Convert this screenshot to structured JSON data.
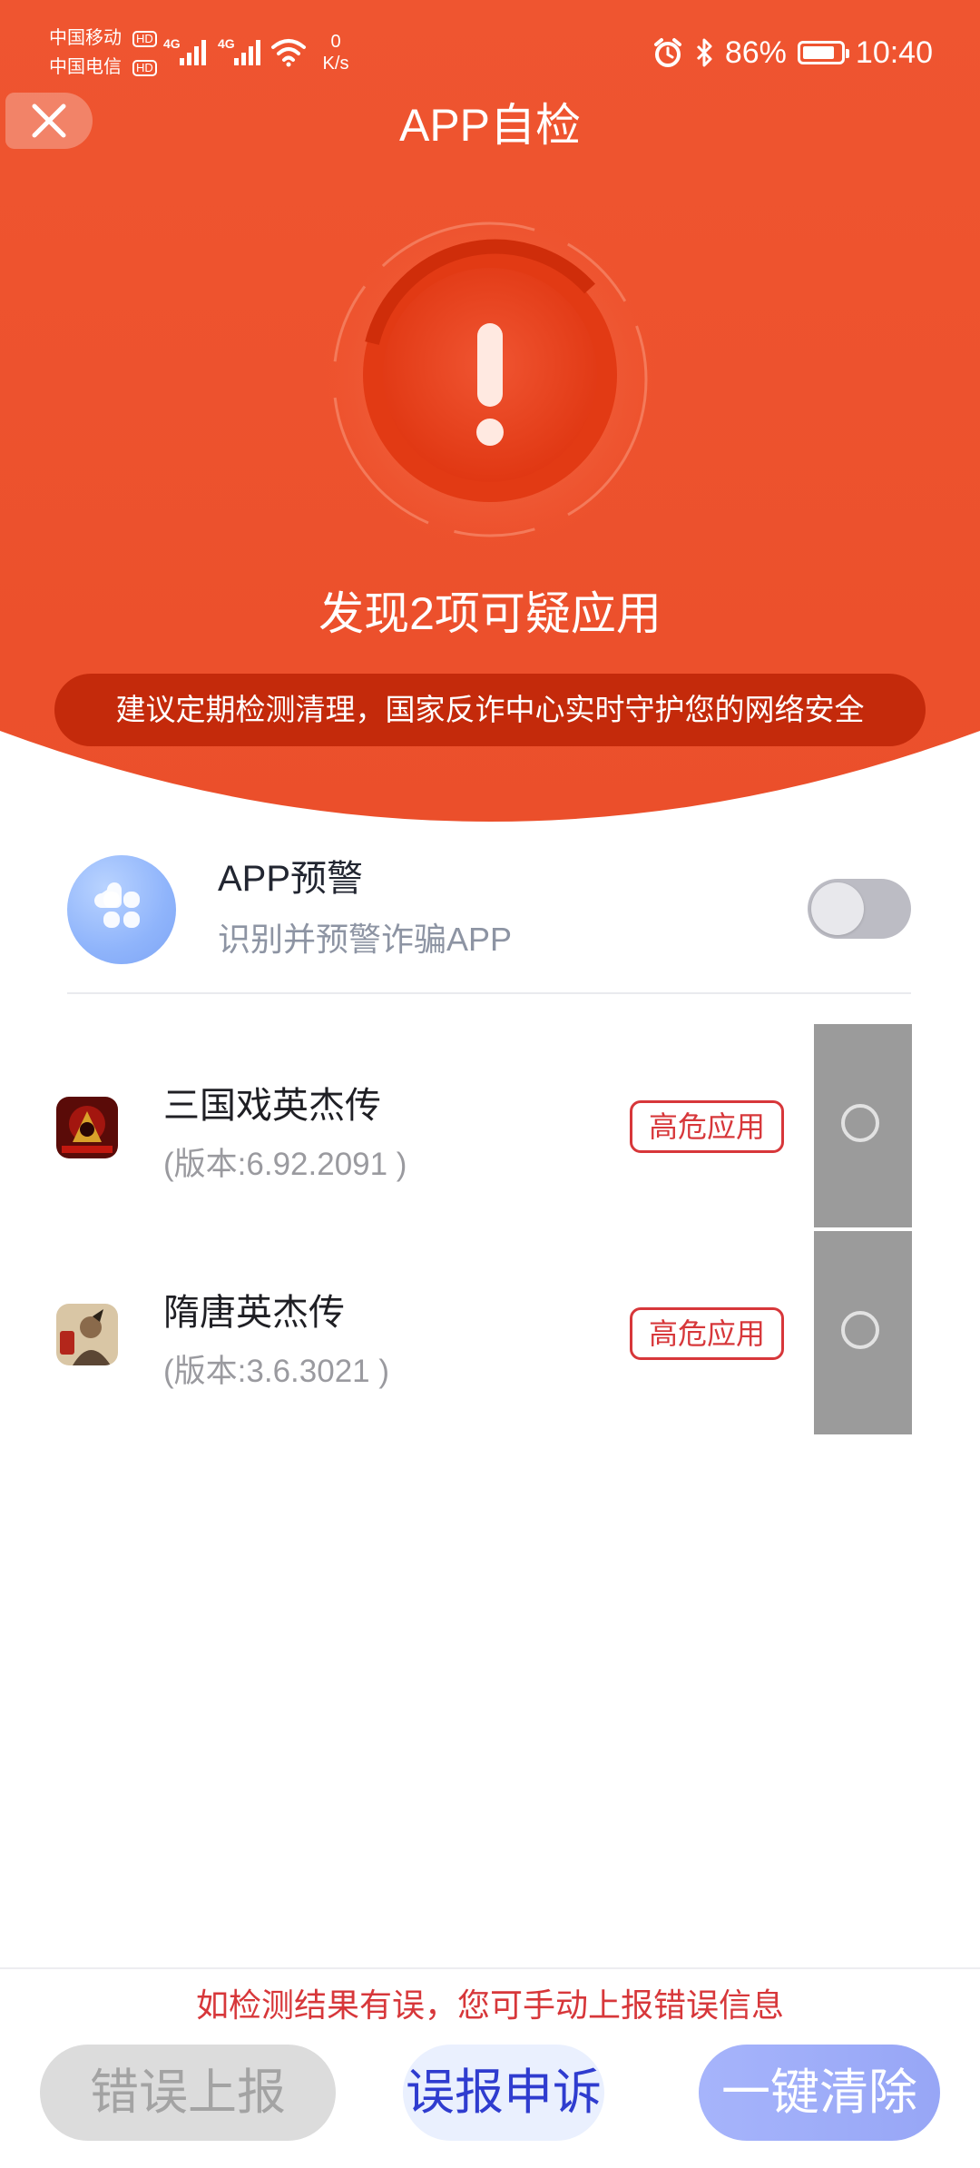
{
  "colors": {
    "hero_red": "#ef5530",
    "pill_dark_red": "#c42a0b",
    "risk_red": "#d7373a",
    "appeal_blue": "#2f3ccf",
    "clear_blue": "#9aa9f7"
  },
  "status_bar": {
    "carrier_1": "中国移动",
    "carrier_2": "中国电信",
    "hd": "HD",
    "network": "4G",
    "speed_value": "0",
    "speed_unit": "K/s",
    "battery_text": "86%",
    "battery_level": 0.86,
    "time": "10:40",
    "icons": [
      "signal-icon",
      "wifi-icon",
      "alarm-icon",
      "bluetooth-icon",
      "battery-icon"
    ]
  },
  "header": {
    "title": "APP自检",
    "close_icon": "close-icon"
  },
  "hero": {
    "icon": "warning-exclamation-icon",
    "title": "发现2项可疑应用",
    "advice": "建议定期检测清理，国家反诈中心实时守护您的网络安全"
  },
  "feature": {
    "icon": "app-grid-icon",
    "title": "APP预警",
    "subtitle": "识别并预警诈骗APP",
    "toggle_on": false
  },
  "apps": [
    {
      "name": "三国戏英杰传",
      "version": "(版本:6.92.2091 )",
      "badge": "高危应用",
      "icon": "app-icon-game",
      "selected": false
    },
    {
      "name": "隋唐英杰传",
      "version": "(版本:3.6.3021 )",
      "badge": "高危应用",
      "icon": "app-icon-game",
      "selected": false
    }
  ],
  "footer": {
    "note": "如检测结果有误，您可手动上报错误信息",
    "report_label": "错误上报",
    "appeal_label": "误报申诉",
    "clear_label": "一键清除"
  }
}
